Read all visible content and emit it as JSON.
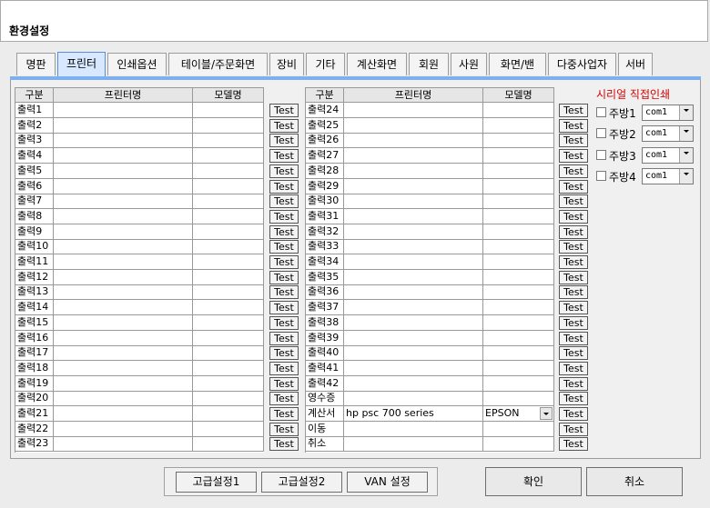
{
  "window": {
    "title": "환경설정"
  },
  "tabs": [
    {
      "label": "명판"
    },
    {
      "label": "프린터"
    },
    {
      "label": "인쇄옵션"
    },
    {
      "label": "테이블/주문화면"
    },
    {
      "label": "장비"
    },
    {
      "label": "기타"
    },
    {
      "label": "계산화면"
    },
    {
      "label": "회원"
    },
    {
      "label": "사원"
    },
    {
      "label": "화면/밴"
    },
    {
      "label": "다중사업자"
    },
    {
      "label": "서버"
    }
  ],
  "active_tab": "프린터",
  "columns": {
    "category": "구분",
    "printer_name": "프린터명",
    "model_name": "모델명"
  },
  "test_label": "Test",
  "left_rows": [
    {
      "category": "출력1",
      "printer": "",
      "model": ""
    },
    {
      "category": "출력2",
      "printer": "",
      "model": ""
    },
    {
      "category": "출력3",
      "printer": "",
      "model": ""
    },
    {
      "category": "출력4",
      "printer": "",
      "model": ""
    },
    {
      "category": "출력5",
      "printer": "",
      "model": ""
    },
    {
      "category": "출력6",
      "printer": "",
      "model": ""
    },
    {
      "category": "출력7",
      "printer": "",
      "model": ""
    },
    {
      "category": "출력8",
      "printer": "",
      "model": ""
    },
    {
      "category": "출력9",
      "printer": "",
      "model": ""
    },
    {
      "category": "출력10",
      "printer": "",
      "model": ""
    },
    {
      "category": "출력11",
      "printer": "",
      "model": ""
    },
    {
      "category": "출력12",
      "printer": "",
      "model": ""
    },
    {
      "category": "출력13",
      "printer": "",
      "model": ""
    },
    {
      "category": "출력14",
      "printer": "",
      "model": ""
    },
    {
      "category": "출력15",
      "printer": "",
      "model": ""
    },
    {
      "category": "출력16",
      "printer": "",
      "model": ""
    },
    {
      "category": "출력17",
      "printer": "",
      "model": ""
    },
    {
      "category": "출력18",
      "printer": "",
      "model": ""
    },
    {
      "category": "출력19",
      "printer": "",
      "model": ""
    },
    {
      "category": "출력20",
      "printer": "",
      "model": ""
    },
    {
      "category": "출력21",
      "printer": "",
      "model": ""
    },
    {
      "category": "출력22",
      "printer": "",
      "model": ""
    },
    {
      "category": "출력23",
      "printer": "",
      "model": ""
    }
  ],
  "right_rows": [
    {
      "category": "출력24",
      "printer": "",
      "model": ""
    },
    {
      "category": "출력25",
      "printer": "",
      "model": ""
    },
    {
      "category": "출력26",
      "printer": "",
      "model": ""
    },
    {
      "category": "출력27",
      "printer": "",
      "model": ""
    },
    {
      "category": "출력28",
      "printer": "",
      "model": ""
    },
    {
      "category": "출력29",
      "printer": "",
      "model": ""
    },
    {
      "category": "출력30",
      "printer": "",
      "model": ""
    },
    {
      "category": "출력31",
      "printer": "",
      "model": ""
    },
    {
      "category": "출력32",
      "printer": "",
      "model": ""
    },
    {
      "category": "출력33",
      "printer": "",
      "model": ""
    },
    {
      "category": "출력34",
      "printer": "",
      "model": ""
    },
    {
      "category": "출력35",
      "printer": "",
      "model": ""
    },
    {
      "category": "출력36",
      "printer": "",
      "model": ""
    },
    {
      "category": "출력37",
      "printer": "",
      "model": ""
    },
    {
      "category": "출력38",
      "printer": "",
      "model": ""
    },
    {
      "category": "출력39",
      "printer": "",
      "model": ""
    },
    {
      "category": "출력40",
      "printer": "",
      "model": ""
    },
    {
      "category": "출력41",
      "printer": "",
      "model": ""
    },
    {
      "category": "출력42",
      "printer": "",
      "model": ""
    },
    {
      "category": "영수증",
      "printer": "",
      "model": ""
    },
    {
      "category": "계산서",
      "printer": "hp psc 700 series",
      "model": "EPSON",
      "dropdown": true
    },
    {
      "category": "이동",
      "printer": "",
      "model": ""
    },
    {
      "category": "취소",
      "printer": "",
      "model": ""
    }
  ],
  "serial": {
    "title": "시리얼 직접인쇄",
    "items": [
      {
        "label": "주방1",
        "port": "com1",
        "checked": false
      },
      {
        "label": "주방2",
        "port": "com1",
        "checked": false
      },
      {
        "label": "주방3",
        "port": "com1",
        "checked": false
      },
      {
        "label": "주방4",
        "port": "com1",
        "checked": false
      }
    ]
  },
  "buttons": {
    "advanced1": "고급설정1",
    "advanced2": "고급설정2",
    "van": "VAN 설정",
    "ok": "확인",
    "cancel": "취소"
  },
  "icons": {
    "dropdown": "chevron-down-icon"
  }
}
